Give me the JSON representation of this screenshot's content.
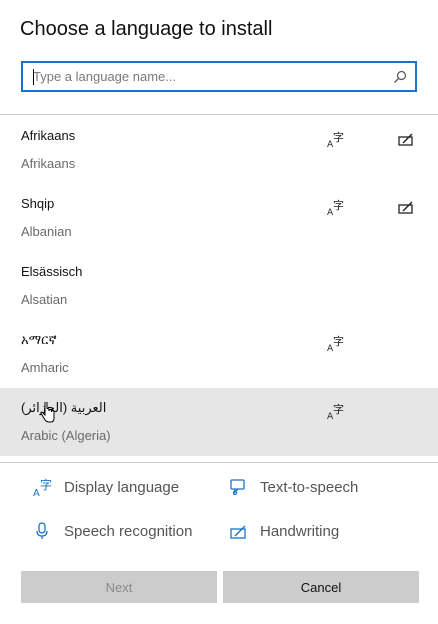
{
  "dialog": {
    "title": "Choose a language to install"
  },
  "search": {
    "placeholder": "Type a language name...",
    "value": ""
  },
  "languages": [
    {
      "native": "Afrikaans",
      "english": "Afrikaans",
      "display_language": true,
      "handwriting": true
    },
    {
      "native": "Shqip",
      "english": "Albanian",
      "display_language": true,
      "handwriting": true
    },
    {
      "native": "Elsässisch",
      "english": "Alsatian",
      "display_language": false,
      "handwriting": false
    },
    {
      "native": "አማርኛ",
      "english": "Amharic",
      "display_language": true,
      "handwriting": false
    },
    {
      "native": "العربية (الجزائر)",
      "english": "Arabic (Algeria)",
      "display_language": true,
      "handwriting": false,
      "hovered": true
    }
  ],
  "legend": {
    "display_language": "Display language",
    "text_to_speech": "Text-to-speech",
    "speech_recognition": "Speech recognition",
    "handwriting": "Handwriting"
  },
  "buttons": {
    "next": "Next",
    "cancel": "Cancel"
  },
  "colors": {
    "accent": "#1a73c8",
    "hover_row": "#e6e6e6",
    "button_bg": "#cccccc"
  }
}
